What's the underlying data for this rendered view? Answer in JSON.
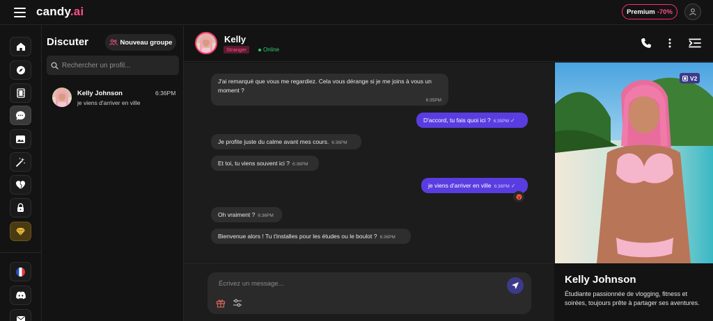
{
  "topbar": {
    "logo_main": "candy",
    "logo_suffix": ".ai",
    "premium_label": "Premium",
    "premium_discount": "-70%"
  },
  "nav": {
    "items": [
      {
        "icon": "home-icon"
      },
      {
        "icon": "compass-icon"
      },
      {
        "icon": "film-icon"
      },
      {
        "icon": "chat-icon",
        "active": true
      },
      {
        "icon": "gallery-icon"
      },
      {
        "icon": "magic-wand-icon"
      },
      {
        "icon": "broken-heart-icon"
      },
      {
        "icon": "lock-icon"
      },
      {
        "icon": "diamond-icon"
      }
    ],
    "bottom_items": [
      {
        "icon": "france-flag-icon"
      },
      {
        "icon": "discord-icon"
      },
      {
        "icon": "mail-icon"
      }
    ]
  },
  "chatlist": {
    "title": "Discuter",
    "new_group_label": "Nouveau groupe",
    "search_placeholder": "Rechercher un profil...",
    "conversations": [
      {
        "name": "Kelly Johnson",
        "preview": "je viens d'arriver en ville",
        "time": "6:36PM"
      }
    ]
  },
  "chat": {
    "name": "Kelly",
    "badge": "Stranger",
    "status": "Online",
    "composer_placeholder": "Écrivez un message...",
    "messages": [
      {
        "dir": "in",
        "text": "J'ai remarqué que vous me regardiez. Cela vous dérange si je me joins à vous un moment ?",
        "time": "6:35PM"
      },
      {
        "dir": "out",
        "text": "D'accord, tu fais quoi ici ?",
        "time": "6:35PM"
      },
      {
        "dir": "in",
        "text": "Je profite juste du calme avant mes cours.",
        "time": "6:36PM"
      },
      {
        "dir": "in",
        "text": "Et toi, tu viens souvent ici ?",
        "time": "6:36PM"
      },
      {
        "dir": "out",
        "text": "je viens d'arriver en ville",
        "time": "6:36PM"
      },
      {
        "dir": "in",
        "text": "Oh vraiment ?",
        "time": "6:36PM"
      },
      {
        "dir": "in",
        "text": "Bienvenue alors ! Tu t'installes pour les études ou le boulot ?",
        "time": "6:36PM"
      }
    ]
  },
  "profile": {
    "version_badge": "V2",
    "name": "Kelly Johnson",
    "bio": "Étudiante passionnée de vlogging, fitness et soirées, toujours prête à partager ses aventures."
  },
  "colors": {
    "accent": "#5a3de0",
    "brand_pink": "#ff4d8d",
    "online": "#2ecc71",
    "background": "#131313"
  }
}
